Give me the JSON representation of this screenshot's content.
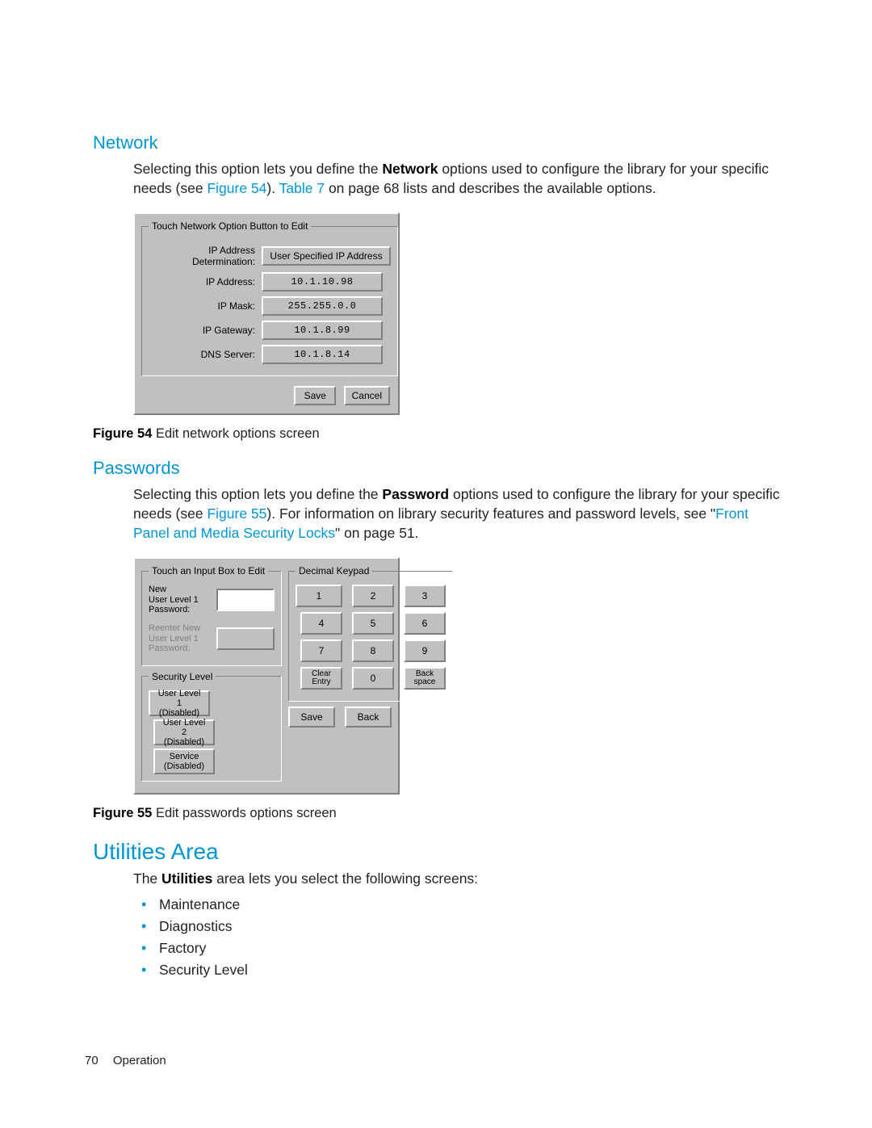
{
  "sections": {
    "network": {
      "heading": "Network",
      "para_pre": "Selecting this option lets you define the ",
      "para_bold": "Network",
      "para_mid": " options used to configure the library for your specific needs (see ",
      "fig_link": "Figure 54",
      "para_mid2": "). ",
      "table_link": "Table 7",
      "para_tail": " on page 68 lists and describes the available options."
    },
    "passwords": {
      "heading": "Passwords",
      "para_pre": "Selecting this option lets you define the ",
      "para_bold": "Password",
      "para_mid": " options used to configure the library for your specific needs (see ",
      "fig_link": "Figure 55",
      "para_mid2": "). For information on library security features and password levels, see \"",
      "sec_link": "Front Panel and Media Security Locks",
      "para_tail": "\" on page 51."
    },
    "utilities": {
      "heading": "Utilities Area",
      "intro_pre": "The ",
      "intro_bold": "Utilities",
      "intro_tail": " area lets you select the following screens:",
      "items": [
        "Maintenance",
        "Diagnostics",
        "Factory",
        "Security Level"
      ]
    }
  },
  "fig54": {
    "caption_label": "Figure 54",
    "caption_text": "Edit network options screen",
    "legend": "Touch Network Option Button to Edit",
    "rows": {
      "ip_det_label": "IP Address Determination:",
      "ip_det_value": "User Specified IP Address",
      "ip_addr_label": "IP Address:",
      "ip_addr_value": "10.1.10.98",
      "ip_mask_label": "IP Mask:",
      "ip_mask_value": "255.255.0.0",
      "ip_gw_label": "IP Gateway:",
      "ip_gw_value": "10.1.8.99",
      "dns_label": "DNS Server:",
      "dns_value": "10.1.8.14"
    },
    "save": "Save",
    "cancel": "Cancel"
  },
  "fig55": {
    "caption_label": "Figure 55",
    "caption_text": "Edit passwords options screen",
    "input_legend": "Touch an Input Box to Edit",
    "pw_new_label": "New\nUser Level 1\nPassword:",
    "pw_re_label": "Reenter New\nUser Level 1\nPassword:",
    "sec_legend": "Security Level",
    "sec_btns": [
      "User Level 1\n(Disabled)",
      "User Level 2\n(Disabled)",
      "Service\n(Disabled)"
    ],
    "keypad_legend": "Decimal Keypad",
    "keys": [
      "1",
      "2",
      "3",
      "4",
      "5",
      "6",
      "7",
      "8",
      "9"
    ],
    "clear": "Clear\nEntry",
    "zero": "0",
    "bksp": "Back\nspace",
    "save": "Save",
    "back": "Back"
  },
  "footer": {
    "page": "70",
    "chapter": "Operation"
  }
}
